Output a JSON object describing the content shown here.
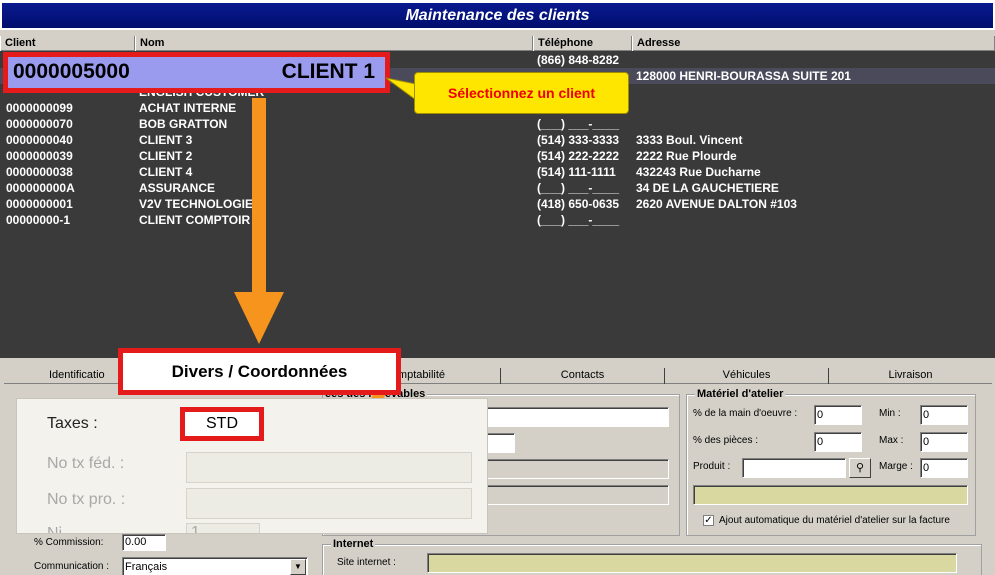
{
  "window": {
    "title": "Maintenance des clients"
  },
  "grid": {
    "headers": {
      "client": "Client",
      "nom": "Nom",
      "telephone": "Téléphone",
      "adresse": "Adresse"
    },
    "rows": [
      {
        "client": "",
        "nom": "",
        "telephone": "(866) 848-8282",
        "adresse": ""
      },
      {
        "client": "0000005000",
        "nom": "CLIENT 1",
        "telephone": "",
        "adresse": "128000 HENRI-BOURASSA SUITE 201"
      },
      {
        "client": "",
        "nom": "ENGLISH CUSTOMER",
        "telephone": "",
        "adresse": ""
      },
      {
        "client": "0000000099",
        "nom": "ACHAT INTERNE",
        "telephone": "",
        "adresse": ""
      },
      {
        "client": "0000000070",
        "nom": "BOB GRATTON",
        "telephone": "(___) ___-____",
        "adresse": ""
      },
      {
        "client": "0000000040",
        "nom": "CLIENT 3",
        "telephone": "(514) 333-3333",
        "adresse": "3333 Boul. Vincent"
      },
      {
        "client": "0000000039",
        "nom": "CLIENT 2",
        "telephone": "(514) 222-2222",
        "adresse": "2222 Rue Plourde"
      },
      {
        "client": "0000000038",
        "nom": "CLIENT 4",
        "telephone": "(514) 111-1111",
        "adresse": "432243 Rue Ducharne"
      },
      {
        "client": "000000000A",
        "nom": "ASSURANCE",
        "telephone": "(___) ___-____",
        "adresse": "34 DE LA GAUCHETIERE"
      },
      {
        "client": "0000000001",
        "nom": "V2V TECHNOLOGIE",
        "telephone": "(418) 650-0635",
        "adresse": "2620 AVENUE DALTON #103"
      },
      {
        "client": "00000000-1",
        "nom": "CLIENT COMPTOIR",
        "telephone": "(___) ___-____",
        "adresse": ""
      }
    ]
  },
  "callouts": {
    "selected_client_code": "0000005000",
    "selected_client_name": "CLIENT 1",
    "tooltip": "Sélectionnez un client",
    "tab_zoom": "Divers / Coordonnées",
    "taxes_label": "Taxes :",
    "taxes_value": "STD",
    "tx_fed_label": "No tx féd. :",
    "tx_pro_label": "No tx pro. :",
    "partial_label": "Ni",
    "partial_value": "1"
  },
  "tabs": [
    "Identification",
    "Comptabilité",
    "Contacts",
    "Véhicules",
    "Livraison"
  ],
  "tabs_partial": {
    "identification": "Identificatio",
    "comptabilite": "mptabilité"
  },
  "recevables": {
    "legend": "Coordonnées des recevables",
    "legend_partial": "ées des recevables"
  },
  "materiel": {
    "legend": "Matériel d'atelier",
    "main_oeuvre_label": "% de la main d'oeuvre :",
    "main_oeuvre_value": "0",
    "pieces_label": "% des pièces :",
    "pieces_value": "0",
    "min_label": "Min :",
    "min_value": "0",
    "max_label": "Max :",
    "max_value": "0",
    "produit_label": "Produit :",
    "marge_label": "Marge :",
    "marge_value": "0",
    "auto_label": "Ajout automatique du matériel d'atelier sur la facture",
    "auto_checked": "✓"
  },
  "bottom_left": {
    "commission_label": "% Commission:",
    "commission_value": "0.00",
    "communication_label": "Communication :",
    "communication_value": "Français"
  },
  "internet": {
    "legend": "Internet",
    "site_label": "Site internet :"
  }
}
